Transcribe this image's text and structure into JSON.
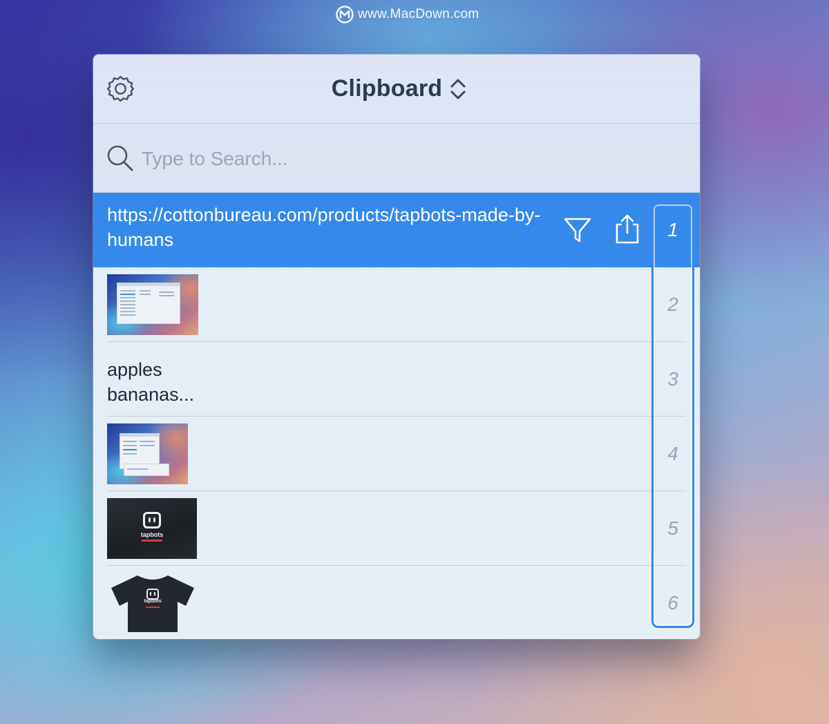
{
  "watermark": {
    "text": "www.MacDown.com"
  },
  "header": {
    "title": "Clipboard"
  },
  "search": {
    "placeholder": "Type to Search..."
  },
  "items": [
    {
      "index": "1",
      "type": "text",
      "lines": [
        "https://cottonbureau.com/products/tapbots-made-by-humans"
      ],
      "selected": true
    },
    {
      "index": "2",
      "type": "image",
      "image": "screenshot-settings-window"
    },
    {
      "index": "3",
      "type": "text",
      "lines": [
        "apples",
        "bananas..."
      ]
    },
    {
      "index": "4",
      "type": "image",
      "image": "screenshot-menu-window"
    },
    {
      "index": "5",
      "type": "image",
      "image": "tapbots-shirt-closeup",
      "image_text": "tapbots"
    },
    {
      "index": "6",
      "type": "image",
      "image": "tapbots-tshirt",
      "image_text": "tapbots"
    }
  ],
  "icons": {
    "settings": "gear-icon",
    "stepper": "chevron-updown-icon",
    "search": "search-icon",
    "filter": "filter-icon",
    "share": "share-icon"
  },
  "colors": {
    "selection": "#3589ea",
    "index_frame": "#3a86e6",
    "title": "#2d3a48",
    "placeholder": "#9aa7b6"
  }
}
